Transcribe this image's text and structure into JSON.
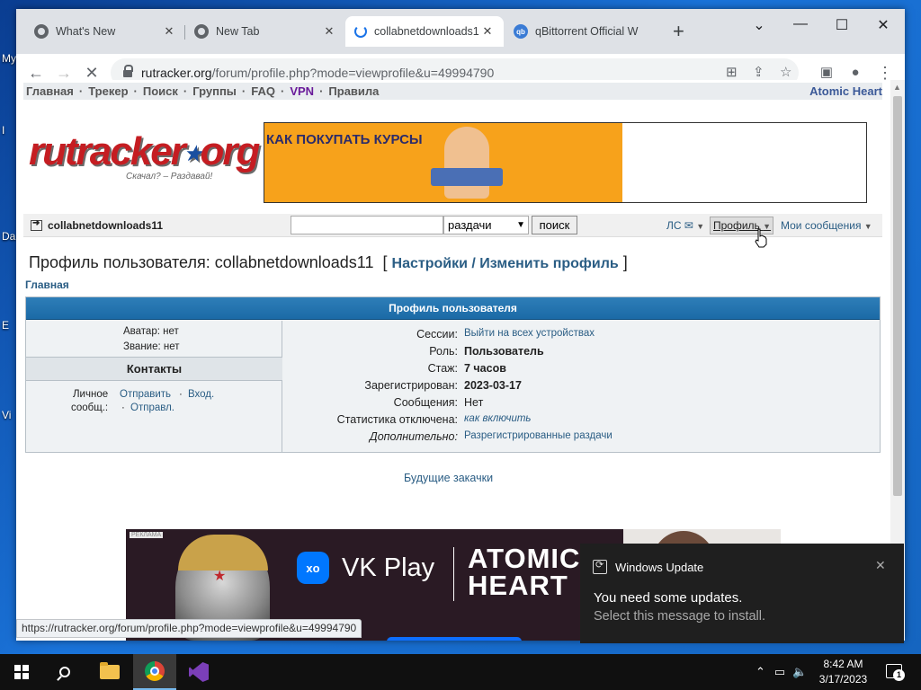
{
  "desktop": {
    "labels": [
      "My",
      "I",
      "Da",
      "E",
      "Vi"
    ]
  },
  "browser": {
    "tabs": [
      {
        "label": "What's New",
        "close": "✕"
      },
      {
        "label": "New Tab",
        "close": "✕"
      },
      {
        "label": "collabnetdownloads1",
        "close": "✕"
      },
      {
        "label": "qBittorrent Official W",
        "close": "✕"
      }
    ],
    "new_tab": "+",
    "window_controls": {
      "dropdown": "⌄",
      "minimize": "—",
      "maximize": "☐",
      "close": "✕"
    },
    "url_host": "rutracker.org",
    "url_path": "/forum/profile.php?mode=viewprofile&u=49994790",
    "status_url": "https://rutracker.org/forum/profile.php?mode=viewprofile&u=49994790"
  },
  "site": {
    "nav": [
      "Главная",
      "Трекер",
      "Поиск",
      "Группы",
      "FAQ",
      "VPN",
      "Правила"
    ],
    "nav_right": "Atomic Heart",
    "logo_text": "rutracker",
    "logo_org": "org",
    "slogan": "Скачал? – Раздавай!",
    "banner_text": "КАК ПОКУПАТЬ КУРСЫ",
    "username": "collabnetdownloads11",
    "search_select": "раздачи",
    "search_button": "поиск",
    "pm_link": "ЛС",
    "profile_link": "Профиль",
    "my_messages": "Мои сообщения",
    "page_title_prefix": "Профиль пользователя: collabnetdownloads11",
    "edit_bracket_open": "[",
    "edit_link": "Настройки / Изменить профиль",
    "edit_bracket_close": "]",
    "breadcrumb": "Главная",
    "table_header": "Профиль пользователя",
    "avatar_label": "Аватар: нет",
    "rank_label": "Звание: нет",
    "contacts_header": "Контакты",
    "pm_label_1": "Личное",
    "pm_label_2": "сообщ.:",
    "pm_send": "Отправить",
    "pm_inbox": "Вход.",
    "pm_sent": "Отправл.",
    "info": [
      {
        "k": "Сессии:",
        "v": "Выйти на всех устройствах"
      },
      {
        "k": "Роль:",
        "v": "Пользователь"
      },
      {
        "k": "Стаж:",
        "v": "7 часов"
      },
      {
        "k": "Зарегистрирован:",
        "v": "2023-03-17"
      },
      {
        "k": "Сообщения:",
        "v": "Нет"
      },
      {
        "k": "Статистика отключена:",
        "v": "как включить"
      },
      {
        "k": "Дополнительно:",
        "v": "Разрегистрированные раздачи"
      }
    ],
    "future_downloads": "Будущие закачки",
    "ad": {
      "vk_logo": "xo",
      "vk_play": "VK Play",
      "atomic_1": "ATOMIC",
      "atomic_2": "HEART",
      "tag": "РЕКЛАМА"
    }
  },
  "toast": {
    "app": "Windows Update",
    "title": "You need some updates.",
    "body": "Select this message to install.",
    "close": "✕"
  },
  "taskbar": {
    "time": "8:42 AM",
    "date": "3/17/2023",
    "notifications": "1"
  }
}
